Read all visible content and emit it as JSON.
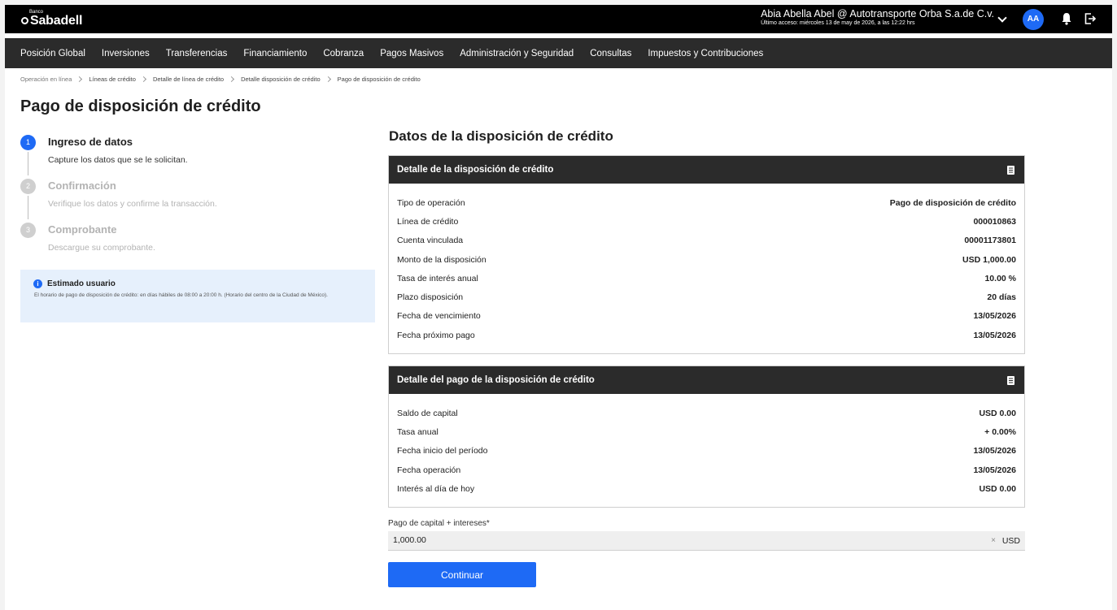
{
  "brand": {
    "small": "Banco",
    "name": "Sabadell"
  },
  "user": {
    "name": "Abia Abella Abel @ Autotransporte Orba S.a.de C.v.",
    "last_access": "Último acceso: miércoles 13 de may de 2026, a las 12:22 hrs",
    "initials": "AA"
  },
  "nav": [
    "Posición Global",
    "Inversiones",
    "Transferencias",
    "Financiamiento",
    "Cobranza",
    "Pagos Masivos",
    "Administración y Seguridad",
    "Consultas",
    "Impuestos y Contribuciones"
  ],
  "breadcrumb": [
    "Operación en línea",
    "Líneas de crédito",
    "Detalle de línea de crédito",
    "Detalle disposición de crédito",
    "Pago de disposición de crédito"
  ],
  "page_title": "Pago de disposición de crédito",
  "steps": [
    {
      "num": "1",
      "title": "Ingreso de datos",
      "desc": "Capture los datos que se le solicitan."
    },
    {
      "num": "2",
      "title": "Confirmación",
      "desc": "Verifique los datos y confirme la transacción."
    },
    {
      "num": "3",
      "title": "Comprobante",
      "desc": "Descargue su comprobante."
    }
  ],
  "notice": {
    "icon": "i",
    "title": "Estimado usuario",
    "text": "El horario de pago de disposición de crédito: en días hábiles de 08:00 a 20:00 h. (Horario del centro de la Ciudad de México)."
  },
  "section_title": "Datos de la disposición de crédito",
  "detail1": {
    "title": "Detalle de la disposición de crédito",
    "rows": [
      {
        "label": "Tipo de operación",
        "value": "Pago de disposición de crédito"
      },
      {
        "label": "Línea de crédito",
        "value": "000010863"
      },
      {
        "label": "Cuenta vinculada",
        "value": "00001173801"
      },
      {
        "label": "Monto de la disposición",
        "value": "USD 1,000.00"
      },
      {
        "label": "Tasa de interés anual",
        "value": "10.00 %"
      },
      {
        "label": "Plazo disposición",
        "value": "20 días"
      },
      {
        "label": "Fecha de vencimiento",
        "value": "13/05/2026"
      },
      {
        "label": "Fecha próximo pago",
        "value": "13/05/2026"
      }
    ]
  },
  "detail2": {
    "title": "Detalle del pago de la disposición de crédito",
    "rows": [
      {
        "label": "Saldo de capital",
        "value": "USD 0.00"
      },
      {
        "label": "Tasa anual",
        "value": "+ 0.00%"
      },
      {
        "label": "Fecha inicio del período",
        "value": "13/05/2026"
      },
      {
        "label": "Fecha operación",
        "value": "13/05/2026"
      },
      {
        "label": "Interés al día de hoy",
        "value": "USD 0.00"
      }
    ]
  },
  "payment": {
    "label": "Pago de capital + intereses*",
    "value": "1,000.00",
    "clear": "×",
    "currency": "USD"
  },
  "continue_label": "Continuar",
  "colors": {
    "primary": "#1e6af5",
    "topbar": "#000000",
    "nav": "#2b2b2b",
    "notice_bg": "#e6f0fc"
  },
  "icons": {
    "dropdown": "chevron-down-icon",
    "notifications": "bell-icon",
    "logout": "logout-icon",
    "card_header": "document-icon"
  }
}
